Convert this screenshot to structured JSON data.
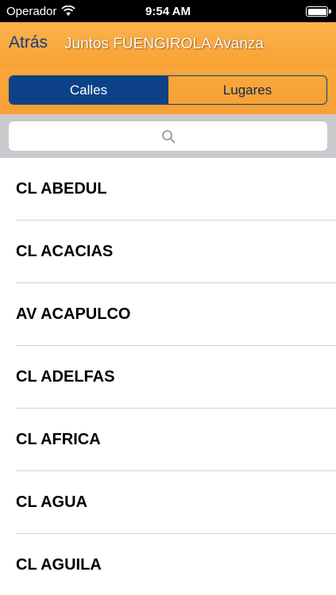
{
  "status_bar": {
    "carrier": "Operador",
    "time": "9:54 AM",
    "wifi_icon": "wifi-icon",
    "battery_icon": "battery-icon"
  },
  "nav": {
    "back_label": "Atrás",
    "title": "Juntos FUENGIROLA Avanza"
  },
  "segments": {
    "items": [
      {
        "label": "Calles",
        "selected": true
      },
      {
        "label": "Lugares",
        "selected": false
      }
    ]
  },
  "search": {
    "placeholder": "",
    "value": "",
    "icon": "search-icon"
  },
  "streets": [
    {
      "label": "CL ABEDUL"
    },
    {
      "label": "CL ACACIAS"
    },
    {
      "label": "AV ACAPULCO"
    },
    {
      "label": "CL ADELFAS"
    },
    {
      "label": "CL AFRICA"
    },
    {
      "label": "CL AGUA"
    },
    {
      "label": "CL AGUILA"
    }
  ],
  "colors": {
    "nav_orange": "#f8a233",
    "segment_blue": "#0d4288",
    "back_blue": "#1c3a82",
    "search_bg": "#c9c9ce"
  }
}
